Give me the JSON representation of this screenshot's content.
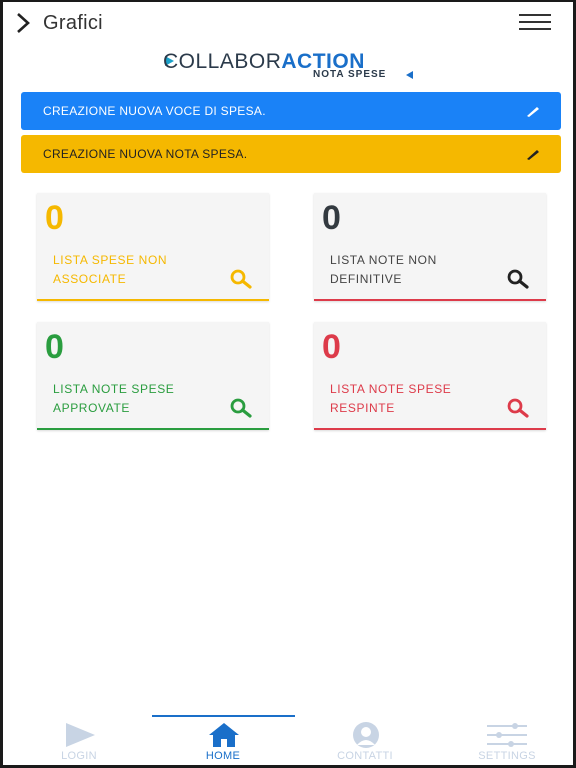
{
  "header": {
    "title": "Grafici"
  },
  "logo": {
    "part1": "COLLABOR",
    "part2": "ACTION",
    "subtitle": "NOTA SPESE"
  },
  "banners": [
    {
      "label": "CREAZIONE NUOVA VOCE DI SPESA."
    },
    {
      "label": "CREAZIONE NUOVA NOTA SPESA."
    }
  ],
  "cards": [
    {
      "count": "0",
      "label": "LISTA SPESE NON ASSOCIATE",
      "color": "#f5b800"
    },
    {
      "count": "0",
      "label": "LISTA NOTE NON DEFINITIVE",
      "color": "#333a40"
    },
    {
      "count": "0",
      "label": "LISTA NOTE SPESE APPROVATE",
      "color": "#2a9d3f"
    },
    {
      "count": "0",
      "label": "LISTA NOTE SPESE RESPINTE",
      "color": "#dd3b4a"
    }
  ],
  "bottom_nav": {
    "items": [
      {
        "label": "LOGIN",
        "icon": "play-icon"
      },
      {
        "label": "HOME",
        "icon": "home-icon",
        "active": true
      },
      {
        "label": "CONTATTI",
        "icon": "user-icon"
      },
      {
        "label": "SETTINGS",
        "icon": "sliders-icon"
      }
    ]
  }
}
